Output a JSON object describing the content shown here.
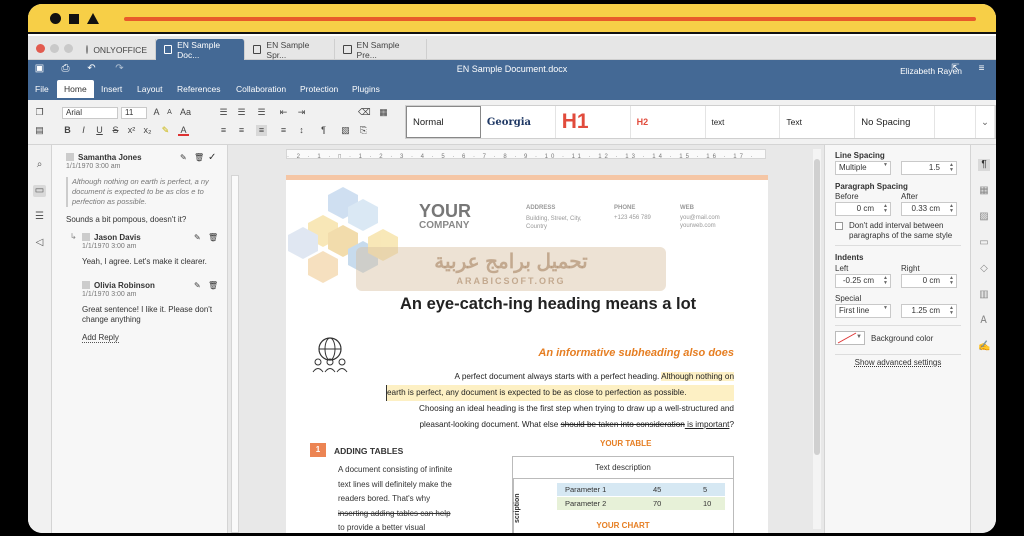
{
  "window": {
    "tabs": [
      {
        "label": "ONLYOFFICE"
      },
      {
        "label": "EN Sample Doc..."
      },
      {
        "label": "EN Sample Spr..."
      },
      {
        "label": "EN Sample Pre..."
      }
    ]
  },
  "header": {
    "doc_title": "EN Sample Document.docx",
    "user": "Elizabeth Rayen"
  },
  "menu": [
    "File",
    "Home",
    "Insert",
    "Layout",
    "References",
    "Collaboration",
    "Protection",
    "Plugins"
  ],
  "toolbar": {
    "font": "Arial",
    "size": "11",
    "styles": [
      "Normal",
      "Georgia",
      "H1",
      "H2",
      "text",
      "Text",
      "No Spacing"
    ]
  },
  "comments": [
    {
      "author": "Samantha Jones",
      "date": "1/1/1970 3:00 am",
      "quote": "Although nothing on earth is perfect, a ny document is expected to be as clos e to perfection as possible.",
      "text": "Sounds a bit pompous, doesn't it?",
      "replies": [
        {
          "author": "Jason Davis",
          "date": "1/1/1970 3:00 am",
          "text": "Yeah, I agree. Let's make it clearer."
        },
        {
          "author": "Olivia Robinson",
          "date": "1/1/1970 3:00 am",
          "text": "Great sentence! I like it. Please don't change anything"
        }
      ],
      "add_reply": "Add Reply"
    }
  ],
  "document": {
    "company": {
      "your": "YOUR",
      "company": "COMPANY"
    },
    "contact": {
      "address_h": "ADDRESS",
      "address": "Building, Street, City, Country",
      "phone_h": "PHONE",
      "phone": "+123 456 789",
      "web_h": "WEB",
      "web1": "you@mail.com",
      "web2": "yourweb.com"
    },
    "watermark_ar": "تحميل برامج عربية",
    "watermark_en": "ARABICSOFT.ORG",
    "heading": "An eye-catch-ing heading means a lot",
    "subheading": "An informative subheading also does",
    "para_plain1": "A perfect document always starts with a perfect heading. ",
    "para_hl1": "Although nothing on",
    "para_hl2": "earth is perfect, any document is expected to be as close to perfection as possible.",
    "para_line3": "Choosing an ideal heading is the first step when trying to draw up a well-structured and",
    "para_line4a": "pleasant-looking document. What else ",
    "para_strike": "should be taken into consideration",
    "para_under": " is important",
    "para_end": "?",
    "section_num": "1",
    "section_title": "ADDING TABLES",
    "section_body": [
      "A document consisting of infinite",
      "text lines will definitely make the",
      "readers bored. That's why",
      "inserting adding tables can help",
      "to provide a better visual"
    ],
    "table_title": "YOUR TABLE",
    "table_head": "Text description",
    "table_side": "scription",
    "table_rows": [
      {
        "label": "Parameter 1",
        "v1": "45",
        "v2": "5"
      },
      {
        "label": "Parameter 2",
        "v1": "70",
        "v2": "10"
      }
    ],
    "chart_title": "YOUR CHART"
  },
  "panel": {
    "line_spacing": "Line Spacing",
    "ls_mode": "Multiple",
    "ls_value": "1.5",
    "para_spacing": "Paragraph Spacing",
    "before": "Before",
    "before_val": "0 cm",
    "after": "After",
    "after_val": "0.33 cm",
    "no_interval": "Don't add interval between paragraphs of the same style",
    "indents": "Indents",
    "left": "Left",
    "left_val": "-0.25 cm",
    "right": "Right",
    "right_val": "0 cm",
    "special": "Special",
    "special_mode": "First line",
    "special_val": "1.25 cm",
    "bg_color": "Background color",
    "advanced": "Show advanced settings"
  }
}
